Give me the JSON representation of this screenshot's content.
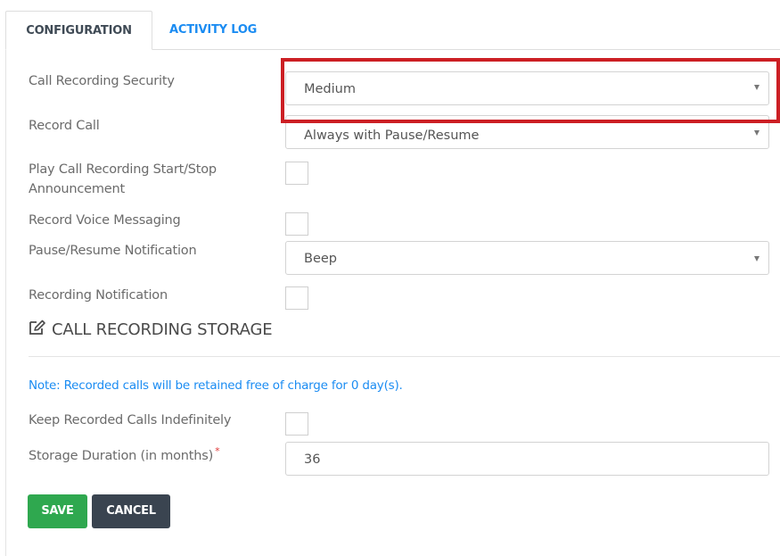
{
  "tabs": [
    {
      "label": "CONFIGURATION",
      "active": true
    },
    {
      "label": "ACTIVITY LOG",
      "active": false
    }
  ],
  "fields": {
    "call_recording_security": {
      "label": "Call Recording Security",
      "value": "Medium"
    },
    "record_call": {
      "label": "Record Call",
      "value": "Always with Pause/Resume"
    },
    "play_announcement": {
      "label_line1": "Play Call Recording Start/Stop",
      "label_line2": "Announcement",
      "checked": false
    },
    "record_voice_messaging": {
      "label": "Record Voice Messaging",
      "checked": false
    },
    "pause_resume_notification": {
      "label": "Pause/Resume Notification",
      "value": "Beep"
    },
    "recording_notification": {
      "label": "Recording Notification",
      "checked": false
    }
  },
  "storage": {
    "section_title": "CALL RECORDING STORAGE",
    "section_icon": "edit-icon",
    "note": "Note: Recorded calls will be retained free of charge for 0 day(s).",
    "keep_indefinitely": {
      "label": "Keep Recorded Calls Indefinitely",
      "checked": false
    },
    "storage_duration": {
      "label": "Storage Duration (in months)",
      "required_mark": "*",
      "value": "36"
    }
  },
  "buttons": {
    "save": "SAVE",
    "cancel": "CANCEL"
  },
  "colors": {
    "accent_link": "#1b8cf2",
    "save": "#2fa84f",
    "cancel": "#3a4450",
    "highlight": "#cc1f24"
  }
}
